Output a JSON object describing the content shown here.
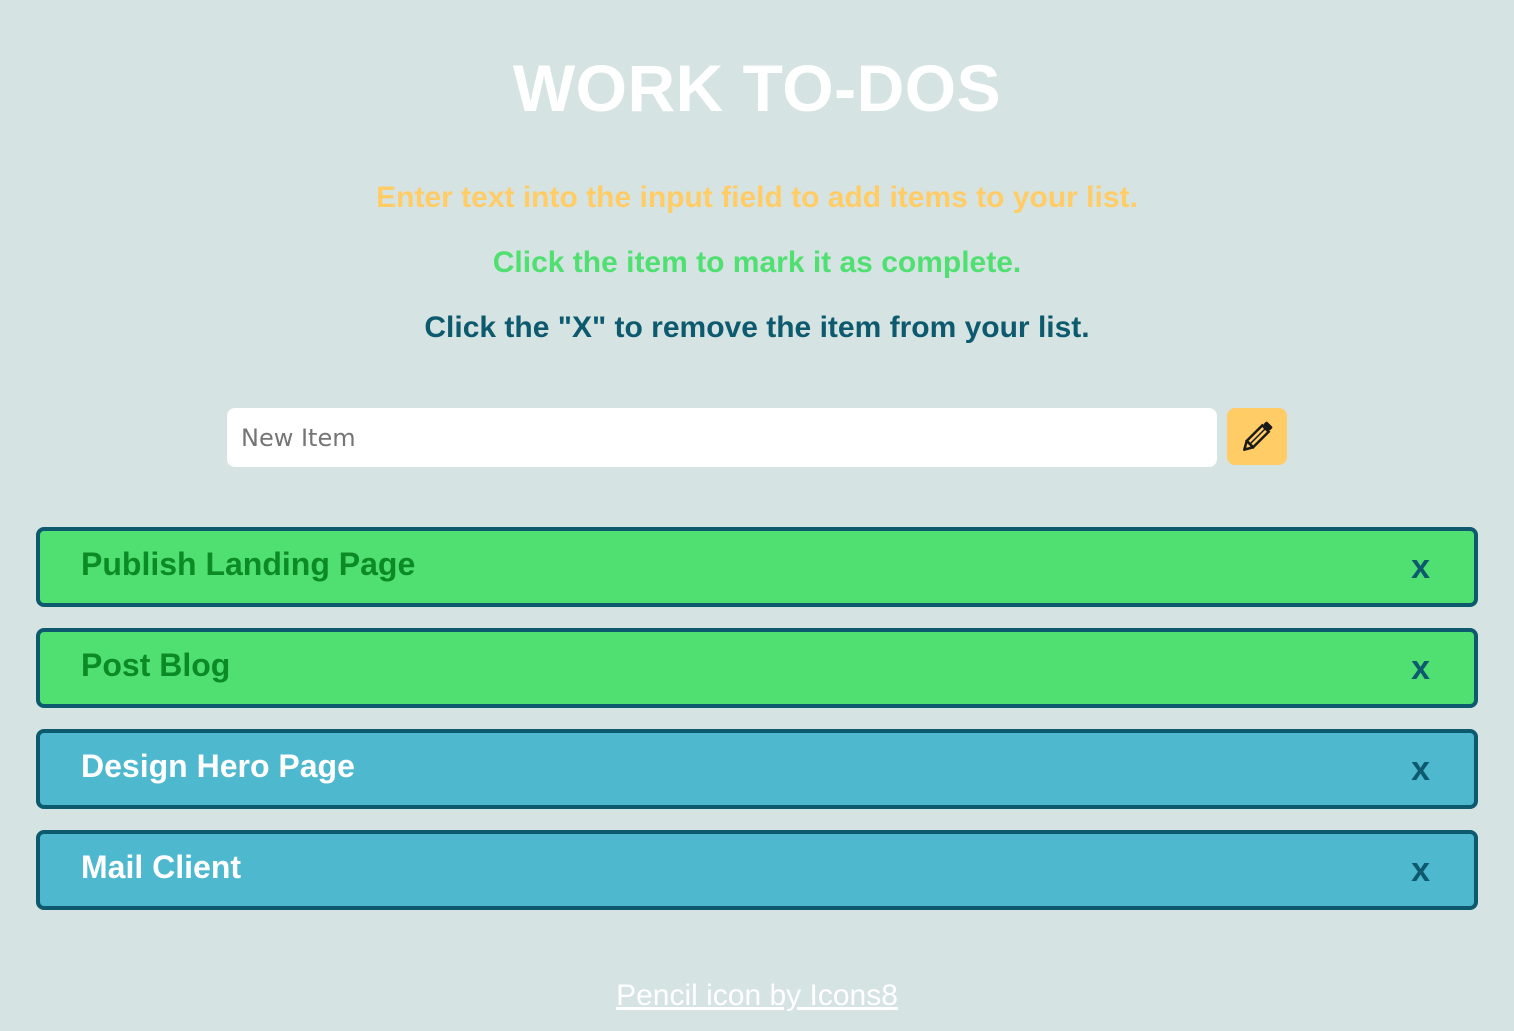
{
  "header": {
    "title": "WORK TO-DOS"
  },
  "instructions": {
    "add": "Enter text into the input field to add items to your list.",
    "complete": "Click the item to mark it as complete.",
    "remove": "Click the \"X\" to remove the item from your list."
  },
  "new_item": {
    "placeholder": "New Item",
    "value": "",
    "button_icon": "pencil-icon"
  },
  "todos": [
    {
      "label": "Publish Landing Page",
      "status": "complete",
      "remove_label": "x"
    },
    {
      "label": "Post Blog",
      "status": "complete",
      "remove_label": "x"
    },
    {
      "label": "Design Hero Page",
      "status": "pending",
      "remove_label": "x"
    },
    {
      "label": "Mail Client",
      "status": "pending",
      "remove_label": "x"
    }
  ],
  "footer": {
    "credit_link": "Pencil icon by Icons8"
  },
  "colors": {
    "background": "#d6e3e3",
    "accent_yellow": "#ffcc66",
    "complete_green": "#50e072",
    "pending_blue": "#4eb8cf",
    "dark_teal": "#0d5a6e"
  }
}
